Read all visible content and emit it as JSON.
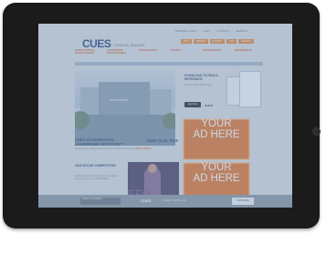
{
  "utility_links": [
    "MEMBER LOGIN",
    "CART",
    "CONTACT",
    "SEARCH"
  ],
  "logo": {
    "text": "CUES",
    "tagline": "POTENTIAL REALIZED"
  },
  "orange_nav": [
    "JOIN",
    "RENEW",
    "EVENTS",
    "FAQ",
    "SEARCH"
  ],
  "top_nav": [
    {
      "label": "PROFESSIONAL DEVELOPMENT"
    },
    {
      "label": "LEADERSHIP DEVELOPMENT"
    },
    {
      "label": "GOVERNANCE"
    },
    {
      "label": "TALENT"
    },
    {
      "label": "INFORMATION"
    },
    {
      "label": "MEMBERSHIP"
    }
  ],
  "hero": {
    "sign": "STANFORD",
    "title_line1": "CUES GOVERNANCE",
    "title_line2": "LEADERSHIP INSTITUTE™",
    "date": "JUNE 13-15, 2018",
    "caption": "Designed for credit union directors to maximize their role",
    "caption_link": "LEARN MORE »"
  },
  "download": {
    "title": "DOWNLOAD TO PASS A REFERENCE",
    "text": "Get the CUES Mobile App",
    "store_badge": "App Store",
    "brand": "cues"
  },
  "ads": [
    {
      "line1": "YOUR",
      "line2": "AD HERE"
    },
    {
      "line1": "YOUR",
      "line2": "AD HERE"
    }
  ],
  "story": {
    "title": "2018 NTCUE COMPETITION",
    "text": "Credit unions share their best ideas. Apply now to compete. LEARN MORE »",
    "image_text": "EFO"
  },
  "footer": {
    "left": "EVENT CALENDAR",
    "logo": "cues",
    "middle": "CONNECT WITH CUES",
    "right": "SUBSCRIBE"
  }
}
